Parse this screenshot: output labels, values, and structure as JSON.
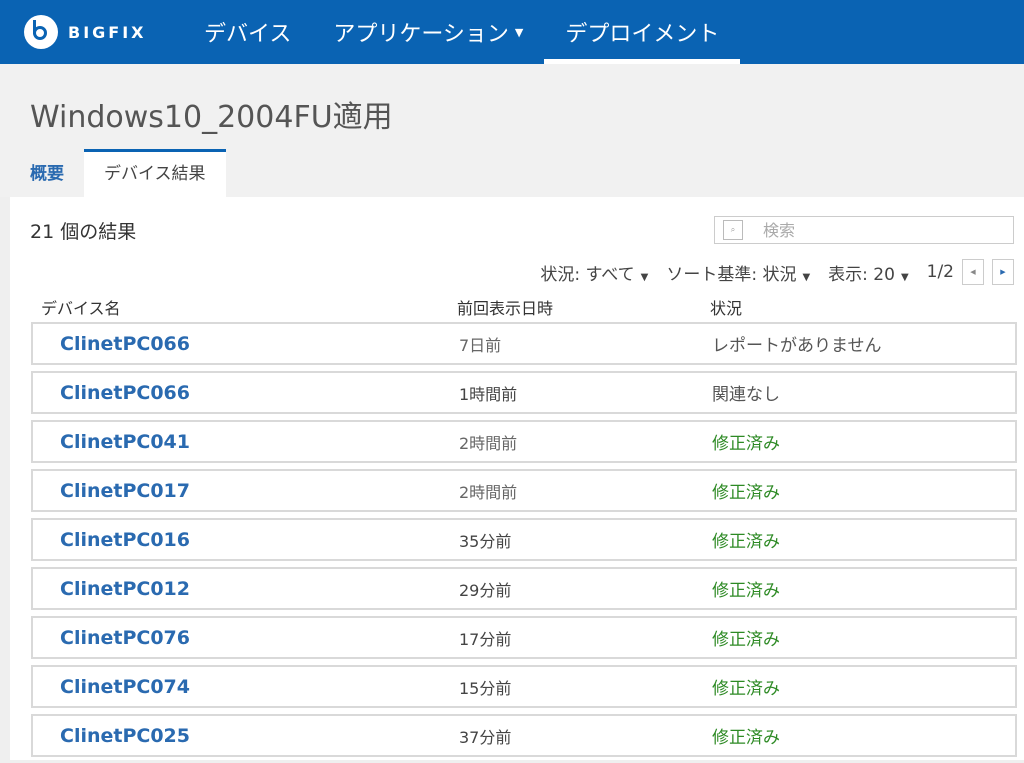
{
  "topbar": {
    "logo_text": "BIGFIX",
    "nav": [
      {
        "label": "デバイス",
        "has_caret": false,
        "active": false
      },
      {
        "label": "アプリケーション",
        "has_caret": true,
        "active": false
      },
      {
        "label": "デプロイメント",
        "has_caret": false,
        "active": true
      }
    ]
  },
  "header": {
    "title": "Windows10_2004FU適用",
    "tabs": [
      {
        "label": "概要",
        "active": false
      },
      {
        "label": "デバイス結果",
        "active": true
      }
    ]
  },
  "main": {
    "result_count": "21 個の結果",
    "search_placeholder": "検索",
    "filters": {
      "status": "状況: すべて",
      "sort": "ソート基準: 状況",
      "display": "表示: 20",
      "page": "1/2"
    },
    "columns": {
      "name": "デバイス名",
      "last_seen": "前回表示日時",
      "status": "状況"
    },
    "rows": [
      {
        "name": "ClinetPC066",
        "last_seen": "7日前",
        "status": "レポートがありません",
        "status_type": "none"
      },
      {
        "name": "ClinetPC066",
        "last_seen": "1時間前",
        "status": "関連なし",
        "status_type": "na"
      },
      {
        "name": "ClinetPC041",
        "last_seen": "2時間前",
        "status": "修正済み",
        "status_type": "fixed"
      },
      {
        "name": "ClinetPC017",
        "last_seen": "2時間前",
        "status": "修正済み",
        "status_type": "fixed"
      },
      {
        "name": "ClinetPC016",
        "last_seen": "35分前",
        "status": "修正済み",
        "status_type": "fixed"
      },
      {
        "name": "ClinetPC012",
        "last_seen": "29分前",
        "status": "修正済み",
        "status_type": "fixed"
      },
      {
        "name": "ClinetPC076",
        "last_seen": "17分前",
        "status": "修正済み",
        "status_type": "fixed"
      },
      {
        "name": "ClinetPC074",
        "last_seen": "15分前",
        "status": "修正済み",
        "status_type": "fixed"
      },
      {
        "name": "ClinetPC025",
        "last_seen": "37分前",
        "status": "修正済み",
        "status_type": "fixed"
      }
    ]
  },
  "colors": {
    "brand": "#0a63b3",
    "link": "#2a6ab0",
    "fixed": "#2d8a24"
  }
}
